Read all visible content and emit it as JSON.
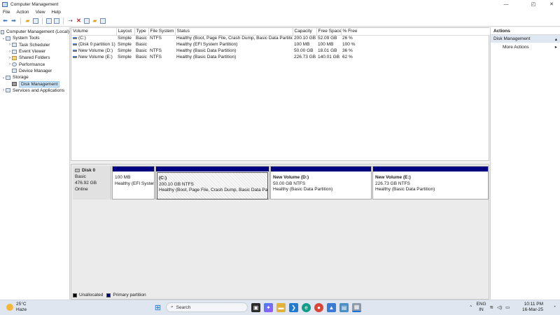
{
  "window": {
    "title": "Computer Management"
  },
  "menu": [
    "File",
    "Action",
    "View",
    "Help"
  ],
  "tree": {
    "root": "Computer Management (Local)",
    "items": [
      {
        "label": "System Tools",
        "level": 1,
        "arrow": "⌄"
      },
      {
        "label": "Task Scheduler",
        "level": 2,
        "arrow": "›"
      },
      {
        "label": "Event Viewer",
        "level": 2,
        "arrow": "›"
      },
      {
        "label": "Shared Folders",
        "level": 2,
        "arrow": "›"
      },
      {
        "label": "Performance",
        "level": 2,
        "arrow": "›"
      },
      {
        "label": "Device Manager",
        "level": 2,
        "arrow": ""
      },
      {
        "label": "Storage",
        "level": 1,
        "arrow": "⌄"
      },
      {
        "label": "Disk Management",
        "level": 2,
        "arrow": "",
        "selected": true
      },
      {
        "label": "Services and Applications",
        "level": 1,
        "arrow": "›"
      }
    ]
  },
  "volumes": {
    "columns": [
      "Volume",
      "Layout",
      "Type",
      "File System",
      "Status",
      "Capacity",
      "Free Space",
      "% Free"
    ],
    "rows": [
      [
        "(C:)",
        "Simple",
        "Basic",
        "NTFS",
        "Healthy (Boot, Page File, Crash Dump, Basic Data Partition)",
        "200.10 GB",
        "52.09 GB",
        "26 %"
      ],
      [
        "(Disk 0 partition 1)",
        "Simple",
        "Basic",
        "",
        "Healthy (EFI System Partition)",
        "100 MB",
        "100 MB",
        "100 %"
      ],
      [
        "New Volume (D:)",
        "Simple",
        "Basic",
        "NTFS",
        "Healthy (Basic Data Partition)",
        "50.00 GB",
        "18.01 GB",
        "36 %"
      ],
      [
        "New Volume (E:)",
        "Simple",
        "Basic",
        "NTFS",
        "Healthy (Basic Data Partition)",
        "226.73 GB",
        "140.01 GB",
        "62 %"
      ]
    ]
  },
  "disk": {
    "name": "Disk 0",
    "type": "Basic",
    "size": "476.92 GB",
    "state": "Online",
    "partitions": [
      {
        "title": "",
        "size": "100 MB",
        "status": "Healthy (EFI System"
      },
      {
        "title": "(C:)",
        "size": "200.10 GB NTFS",
        "status": "Healthy (Boot, Page File, Crash Dump, Basic Data Partitic",
        "selected": true
      },
      {
        "title": "New Volume  (D:)",
        "size": "50.00 GB NTFS",
        "status": "Healthy (Basic Data Partition)"
      },
      {
        "title": "New Volume  (E:)",
        "size": "226.73 GB NTFS",
        "status": "Healthy (Basic Data Partition)"
      }
    ]
  },
  "legend": {
    "unallocated": "Unallocated",
    "primary": "Primary partition",
    "unallocated_color": "#000000",
    "primary_color": "#000080"
  },
  "actions": {
    "header": "Actions",
    "section": "Disk Management",
    "more": "More Actions"
  },
  "taskbar": {
    "temperature": "25°C",
    "condition": "Haze",
    "search_placeholder": "Search",
    "lang_top": "ENG",
    "lang_bottom": "IN",
    "time": "10:11 PM",
    "date": "16-Mar-25"
  }
}
